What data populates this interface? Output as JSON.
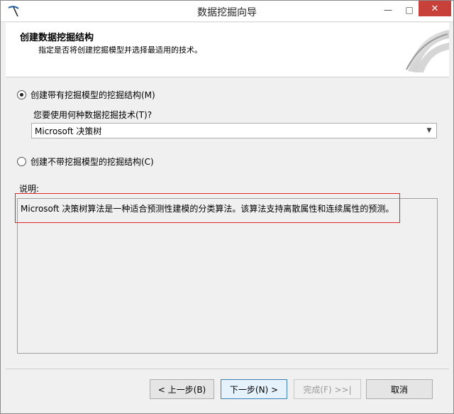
{
  "window": {
    "title": "数据挖掘向导",
    "min_glyph": "—",
    "max_glyph": "□",
    "close_glyph": "✕"
  },
  "header": {
    "title": "创建数据挖掘结构",
    "subtitle": "指定是否将创建挖掘模型并选择最适用的技术。"
  },
  "options": {
    "with_model": {
      "label": "创建带有挖掘模型的挖掘结构(M)",
      "checked": true
    },
    "technique_question": "您要使用何种数据挖掘技术(T)?",
    "technique_value": "Microsoft 决策树",
    "without_model": {
      "label": "创建不带挖掘模型的挖掘结构(C)",
      "checked": false
    }
  },
  "description": {
    "label": "说明:",
    "text": "Microsoft 决策树算法是一种适合预测性建模的分类算法。该算法支持离散属性和连续属性的预测。",
    "highlight_color": "#e0262a"
  },
  "footer": {
    "back": "< 上一步(B)",
    "next": "下一步(N) >",
    "finish": "完成(F) >>|",
    "cancel": "取消"
  },
  "colors": {
    "close_button": "#c7403a",
    "primary_border": "#3c7fb1"
  }
}
